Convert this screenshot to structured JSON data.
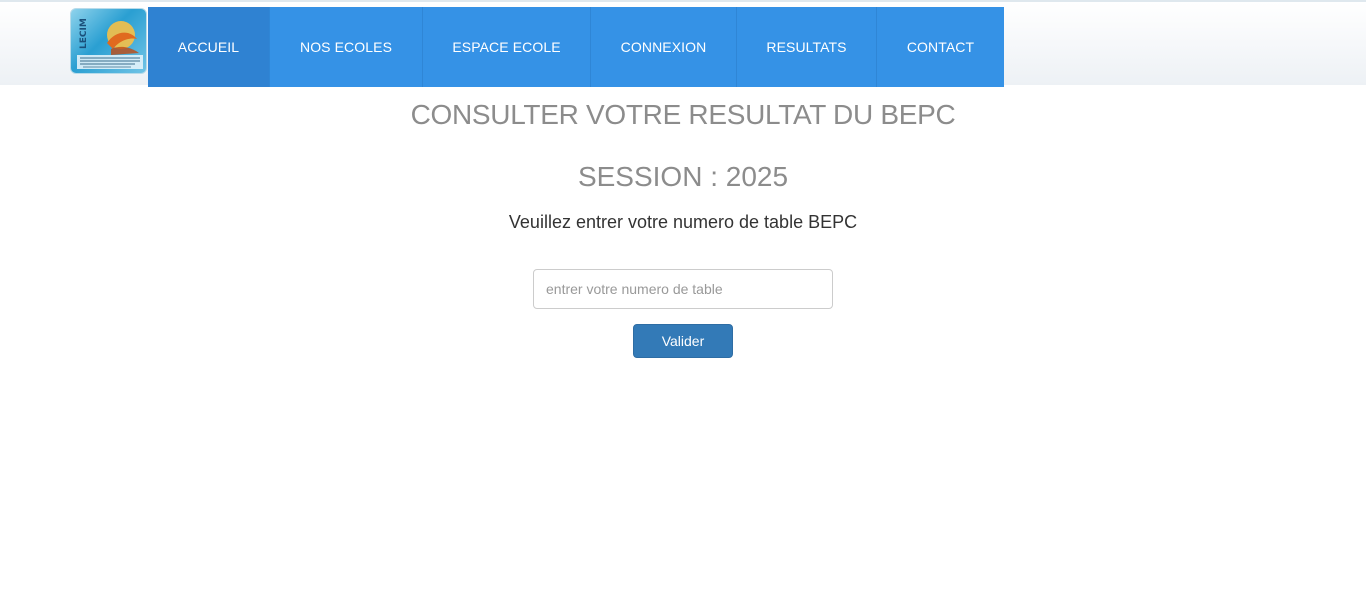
{
  "header": {
    "logo_text": "LECIM",
    "nav": [
      {
        "label": "ACCUEIL",
        "active": true
      },
      {
        "label": "NOS ECOLES",
        "active": false
      },
      {
        "label": "ESPACE ECOLE",
        "active": false
      },
      {
        "label": "CONNEXION",
        "active": false
      },
      {
        "label": "RESULTATS",
        "active": false
      },
      {
        "label": "CONTACT",
        "active": false
      }
    ]
  },
  "main": {
    "title": "CONSULTER VOTRE RESULTAT DU BEPC",
    "session": "SESSION : 2025",
    "instruction": "Veuillez entrer votre numero de table BEPC",
    "input": {
      "value": "",
      "placeholder": "entrer votre numero de table"
    },
    "submit_label": "Valider"
  },
  "colors": {
    "nav_bg": "#3592e6",
    "nav_active": "#2f82d2",
    "button": "#337ab7",
    "heading": "#8c8c8c"
  }
}
